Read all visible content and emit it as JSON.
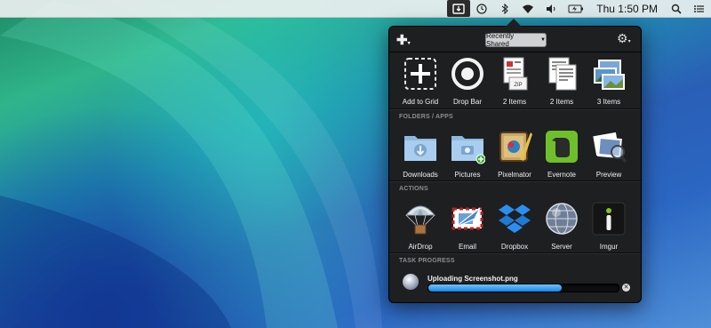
{
  "menubar": {
    "clock": "Thu  1:50 PM",
    "icons": [
      "dropzone-icon",
      "time-machine-icon",
      "bluetooth-icon",
      "wifi-icon",
      "volume-icon",
      "battery-icon",
      "spotlight-icon",
      "notification-center-icon"
    ]
  },
  "popover": {
    "plus_label": "✚",
    "dropdown_label": "Recently Shared",
    "gear_label": "⚙",
    "top_tiles": [
      {
        "label": "Add to Grid"
      },
      {
        "label": "Drop Bar"
      },
      {
        "label": "2 Items",
        "badge": "ZIP"
      },
      {
        "label": "2 Items"
      },
      {
        "label": "3 Items"
      }
    ],
    "folders_title": "FOLDERS / APPS",
    "folders": [
      {
        "label": "Downloads"
      },
      {
        "label": "Pictures"
      },
      {
        "label": "Pixelmator"
      },
      {
        "label": "Evernote"
      },
      {
        "label": "Preview"
      }
    ],
    "actions_title": "ACTIONS",
    "actions": [
      {
        "label": "AirDrop"
      },
      {
        "label": "Email"
      },
      {
        "label": "Dropbox"
      },
      {
        "label": "Server"
      },
      {
        "label": "Imgur"
      }
    ],
    "task_title": "TASK PROGRESS",
    "task": {
      "name": "Uploading Screenshot.png",
      "progress": 0.7,
      "cancel_label": "✕"
    }
  }
}
